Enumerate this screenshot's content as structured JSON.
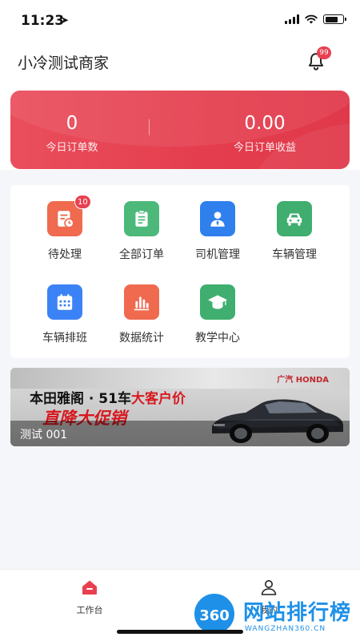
{
  "status_bar": {
    "time": "11:23"
  },
  "header": {
    "title": "小冷测试商家",
    "notification_count": "99"
  },
  "stats": [
    {
      "value": "0",
      "label": "今日订单数"
    },
    {
      "value": "0.00",
      "label": "今日订单收益"
    }
  ],
  "menu": [
    {
      "label": "待处理",
      "icon": "pending-orders-icon",
      "color": "#ef6a4f",
      "badge": "10"
    },
    {
      "label": "全部订单",
      "icon": "clipboard-icon",
      "color": "#4cb87a"
    },
    {
      "label": "司机管理",
      "icon": "driver-icon",
      "color": "#2f80ed"
    },
    {
      "label": "车辆管理",
      "icon": "car-icon",
      "color": "#3fae6f"
    },
    {
      "label": "车辆排班",
      "icon": "calendar-icon",
      "color": "#3b82f6"
    },
    {
      "label": "数据统计",
      "icon": "bar-chart-icon",
      "color": "#ef6a4f"
    },
    {
      "label": "教学中心",
      "icon": "graduation-cap-icon",
      "color": "#3fae6f"
    }
  ],
  "banner": {
    "brand": "广汽 HONDA",
    "headline_part1": "本田雅阁 · 51车",
    "headline_part2": "大客户价",
    "subheadline": "直降大促销",
    "caption": "测试 001"
  },
  "tabbar": [
    {
      "label": "工作台",
      "icon": "workbench-icon",
      "active": true,
      "color": "#e84050"
    },
    {
      "label": "我的",
      "icon": "user-icon",
      "active": false
    }
  ],
  "watermark": {
    "badge": "360",
    "text": "网站排行榜",
    "sub": "WANGZHAN360.CN"
  }
}
